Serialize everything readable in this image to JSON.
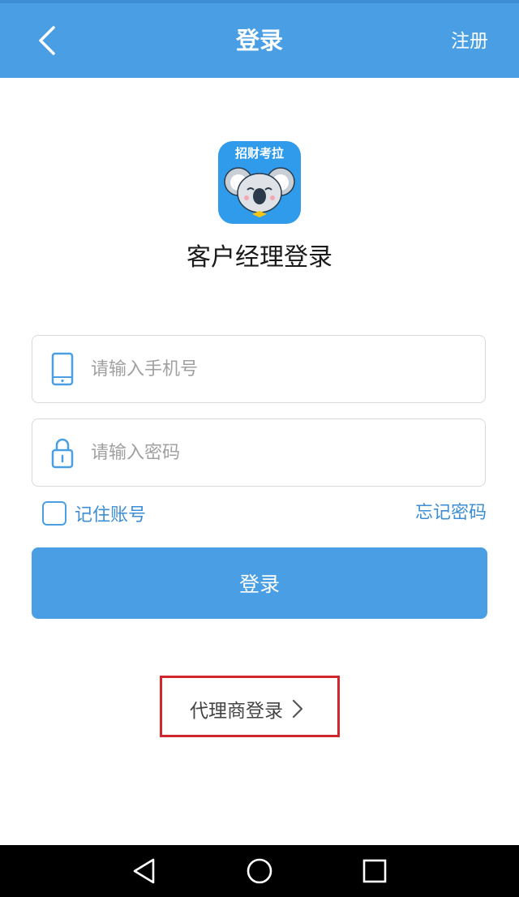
{
  "header": {
    "title": "登录",
    "register_label": "注册",
    "back_icon": "chevron-left-icon",
    "background_color": "#4a9fe4"
  },
  "logo": {
    "text": "招财考拉",
    "icon": "koala-icon",
    "background_color": "#2f9bea"
  },
  "page": {
    "subtitle": "客户经理登录"
  },
  "form": {
    "phone": {
      "placeholder": "请输入手机号",
      "value": "",
      "icon": "phone-icon"
    },
    "password": {
      "placeholder": "请输入密码",
      "value": "",
      "icon": "lock-icon"
    },
    "remember_label": "记住账号",
    "remember_checked": false,
    "forgot_label": "忘记密码",
    "submit_label": "登录"
  },
  "agent_login": {
    "label": "代理商登录",
    "icon": "chevron-right-icon",
    "highlight_color": "#d0262e"
  },
  "navbar": {
    "back_icon": "triangle-back-icon",
    "home_icon": "circle-home-icon",
    "recents_icon": "square-recents-icon"
  },
  "accent_color": "#3d8ed4"
}
